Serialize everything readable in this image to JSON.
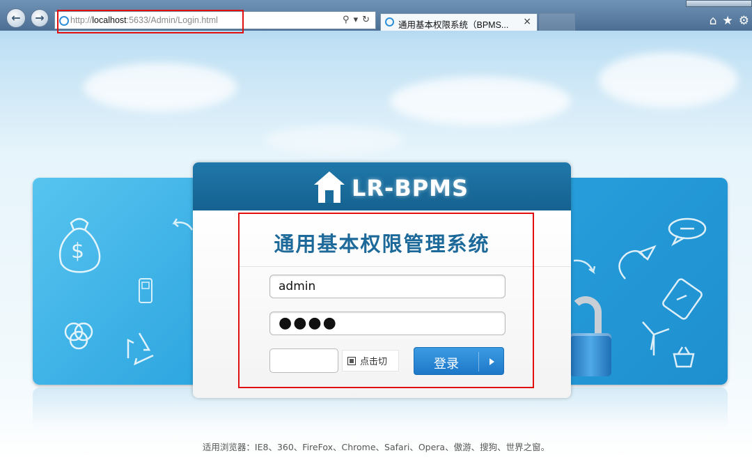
{
  "browser": {
    "url_prefix": "http://",
    "url_host": "localhost",
    "url_path": ":5633/Admin/Login.html",
    "tab_title": "通用基本权限系统（BPMS...",
    "tab_close": "×",
    "back_icon": "back-arrow-icon",
    "forward_icon": "forward-arrow-icon",
    "toolbar_icons": [
      "home-icon",
      "star-icon",
      "gear-icon"
    ]
  },
  "header": {
    "logo_text": "LR-BPMS"
  },
  "login": {
    "system_title": "通用基本权限管理系统",
    "username_value": "admin",
    "password_mask": "●●●●",
    "captcha_alt": "点击切",
    "login_label": "登录"
  },
  "footer": {
    "browsers_note": "适用浏览器：IE8、360、FireFox、Chrome、Safari、Opera、傲游、搜狗、世界之窗。"
  },
  "colors": {
    "highlight": "#e01010",
    "header_blue": "#1f78aa",
    "title_blue": "#1d6a9a",
    "button_blue": "#2a88d4"
  }
}
